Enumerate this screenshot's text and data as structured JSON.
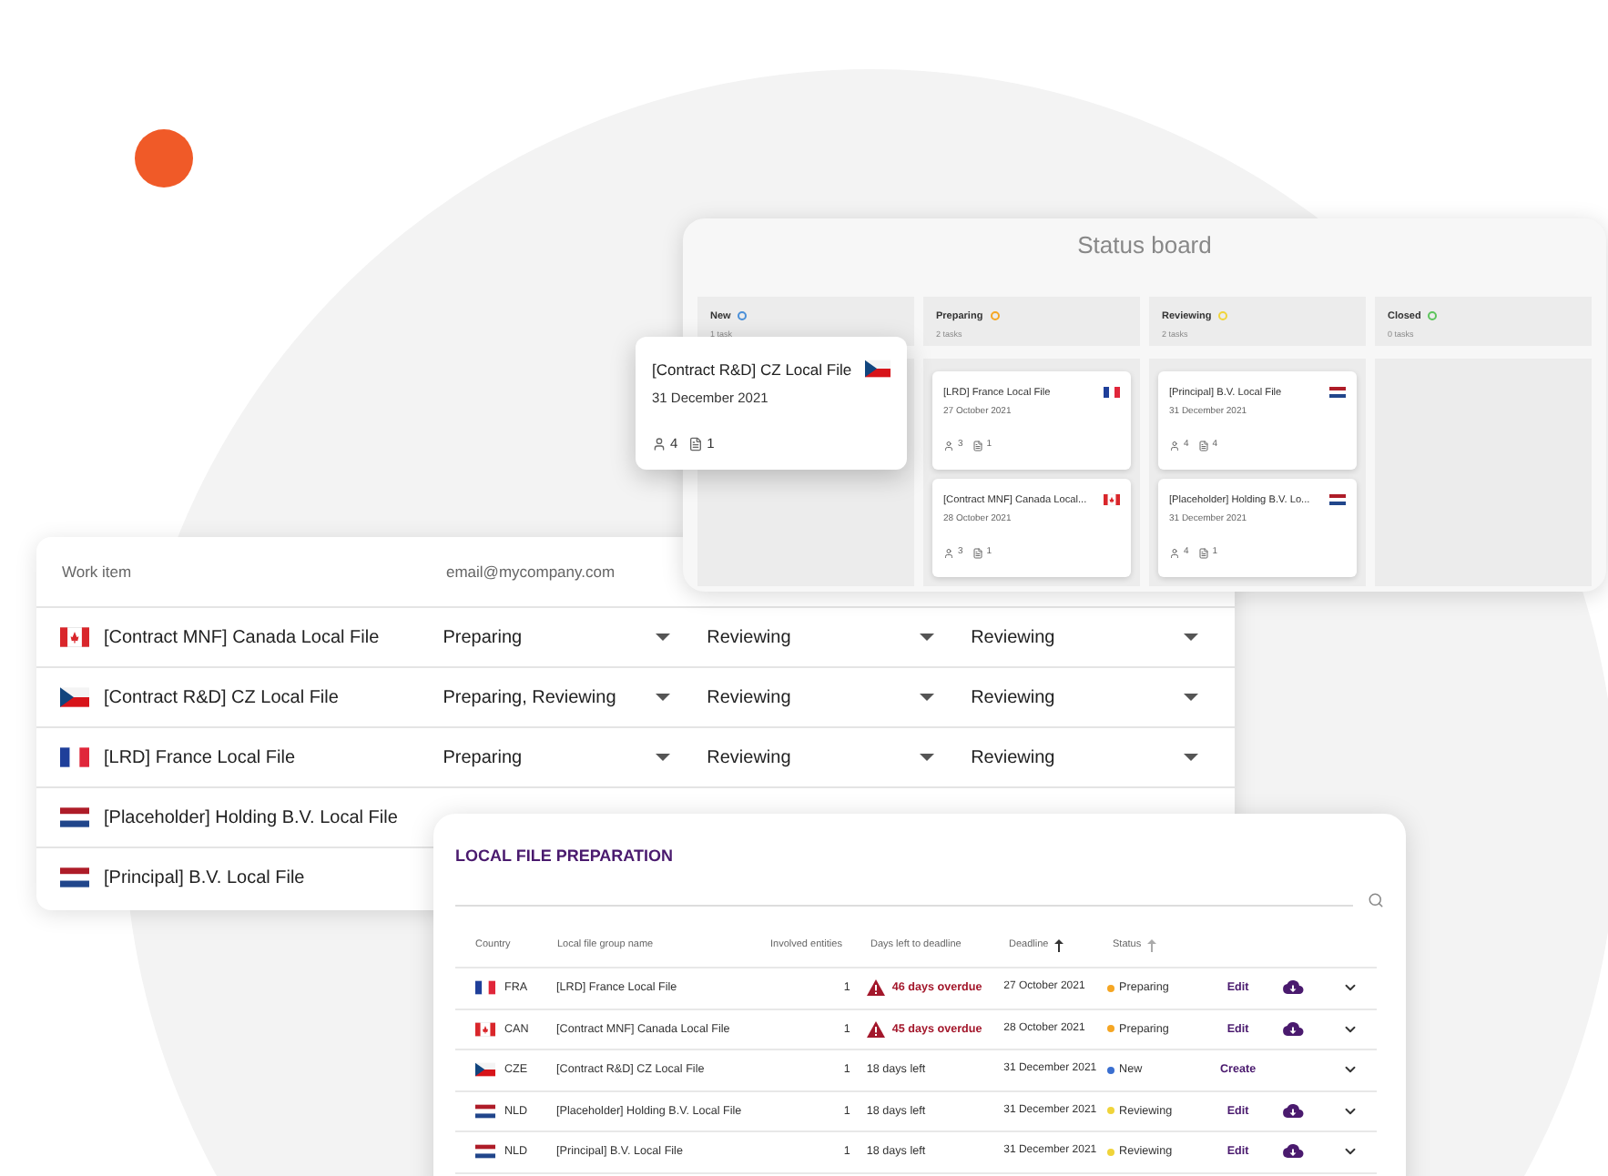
{
  "status_board": {
    "title": "Status board",
    "columns": [
      {
        "name": "New",
        "count": "1 task",
        "color": "#4a8fd8"
      },
      {
        "name": "Preparing",
        "count": "2 tasks",
        "color": "#f5a623",
        "cards": [
          {
            "title": "[LRD] France Local File",
            "kind": "fr",
            "date": "27 October 2021",
            "people": "3",
            "files": "1"
          },
          {
            "title": "[Contract MNF] Canada Local...",
            "kind": "ca",
            "date": "28 October 2021",
            "people": "3",
            "files": "1"
          }
        ]
      },
      {
        "name": "Reviewing",
        "count": "2 tasks",
        "color": "#f0d43a",
        "cards": [
          {
            "title": "[Principal] B.V. Local File",
            "kind": "nl",
            "date": "31 December 2021",
            "people": "4",
            "files": "4"
          },
          {
            "title": "[Placeholder] Holding B.V. Lo...",
            "kind": "nl",
            "date": "31 December 2021",
            "people": "4",
            "files": "1"
          }
        ]
      },
      {
        "name": "Closed",
        "count": "0 tasks",
        "color": "#5cc45c"
      }
    ]
  },
  "dragged_card": {
    "title": "[Contract R&D] CZ Local File",
    "kind": "cz",
    "date": "31 December 2021",
    "people": "4",
    "files": "1"
  },
  "work_items": {
    "columns": [
      "Work item",
      "email@mycompany.com"
    ],
    "rows": [
      {
        "kind": "ca",
        "cells": [
          "[Contract MNF] Canada Local File",
          "Preparing",
          "Reviewing",
          "Reviewing"
        ]
      },
      {
        "kind": "cz",
        "cells": [
          "[Contract R&D] CZ Local File",
          "Preparing, Reviewing",
          "Reviewing",
          "Reviewing"
        ]
      },
      {
        "kind": "fr",
        "cells": [
          "[LRD] France Local File",
          "Preparing",
          "Reviewing",
          "Reviewing"
        ]
      },
      {
        "kind": "nl",
        "cells": [
          "[Placeholder] Holding B.V. Local File"
        ]
      },
      {
        "kind": "nl",
        "cells": [
          "[Principal] B.V. Local File"
        ]
      }
    ]
  },
  "local_file_preparation": {
    "title": "LOCAL FILE PREPARATION",
    "columns": [
      {
        "label": "Country",
        "kind": "plain"
      },
      {
        "label": "Local file group name",
        "kind": "plain"
      },
      {
        "label": "Involved entities",
        "kind": "plain"
      },
      {
        "label": "Days left to deadline",
        "kind": "plain"
      },
      {
        "label": "Deadline",
        "kind": "sorted"
      },
      {
        "label": "Status",
        "kind": "sortable"
      }
    ],
    "rows": [
      {
        "kind": "fr",
        "code": "FRA",
        "name": "[LRD] France Local File",
        "entities": "1",
        "days": "46 days overdue",
        "overdue": true,
        "deadline": "27 October 2021",
        "status": "Preparing",
        "color": "#f5a623",
        "action": "Edit",
        "download": true
      },
      {
        "kind": "ca",
        "code": "CAN",
        "name": "[Contract MNF] Canada Local File",
        "entities": "1",
        "days": "45 days overdue",
        "overdue": true,
        "deadline": "28 October 2021",
        "status": "Preparing",
        "color": "#f5a623",
        "action": "Edit",
        "download": true
      },
      {
        "kind": "cz",
        "code": "CZE",
        "name": "[Contract R&D] CZ Local File",
        "entities": "1",
        "days": "18 days left",
        "overdue": false,
        "deadline": "31 December 2021",
        "status": "New",
        "color": "#3a6fd0",
        "action": "Create",
        "download": false
      },
      {
        "kind": "nl",
        "code": "NLD",
        "name": "[Placeholder] Holding B.V. Local File",
        "entities": "1",
        "days": "18 days left",
        "overdue": false,
        "deadline": "31 December 2021",
        "status": "Reviewing",
        "color": "#f0d43a",
        "action": "Edit",
        "download": true
      },
      {
        "kind": "nl",
        "code": "NLD",
        "name": "[Principal] B.V. Local File",
        "entities": "1",
        "days": "18 days left",
        "overdue": false,
        "deadline": "31 December 2021",
        "status": "Reviewing",
        "color": "#f0d43a",
        "action": "Edit",
        "download": true
      }
    ]
  }
}
